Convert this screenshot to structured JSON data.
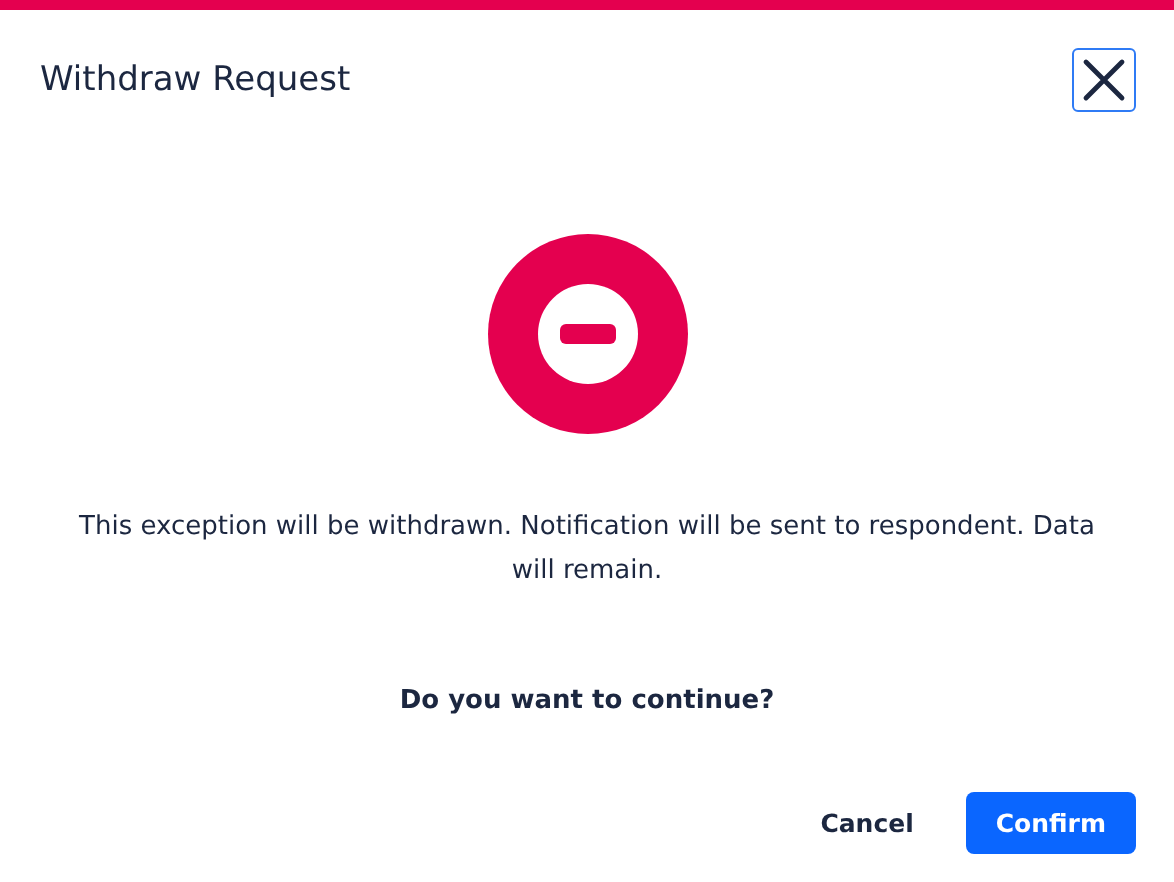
{
  "dialog": {
    "title": "Withdraw Request",
    "message": "This exception will be withdrawn. Notification will be sent to respondent. Data will remain.",
    "question": "Do you want to continue?",
    "buttons": [
      {
        "label": "Cancel",
        "kind": "secondary"
      },
      {
        "label": "Confirm",
        "kind": "primary"
      }
    ]
  }
}
